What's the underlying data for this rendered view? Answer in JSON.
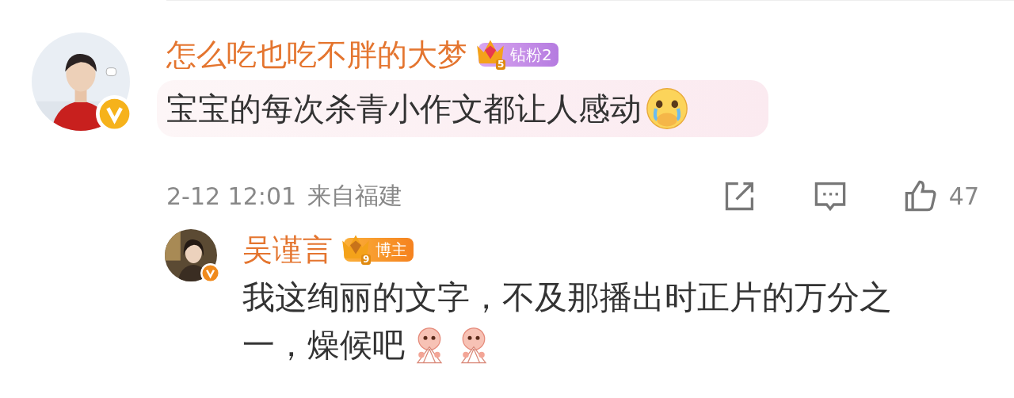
{
  "comment": {
    "author": "怎么吃也吃不胖的大梦",
    "verified": true,
    "badge": {
      "level": "5",
      "label": "钻粉2",
      "kind": "fan"
    },
    "text": "宝宝的每次杀青小作文都让人感动",
    "highlighted": true,
    "emojis": [
      {
        "kind": "crying"
      }
    ],
    "time": "2-12 12:01",
    "location": "来自福建",
    "likes": "47"
  },
  "reply": {
    "author": "吴谨言",
    "verified": true,
    "badge": {
      "level": "9",
      "label": "博主",
      "kind": "author"
    },
    "text_lines": [
      "我这绚丽的文字，不及那播出时正片的万分之",
      "一，燥候吧"
    ],
    "emojis": [
      {
        "kind": "fan"
      },
      {
        "kind": "fan"
      }
    ]
  }
}
